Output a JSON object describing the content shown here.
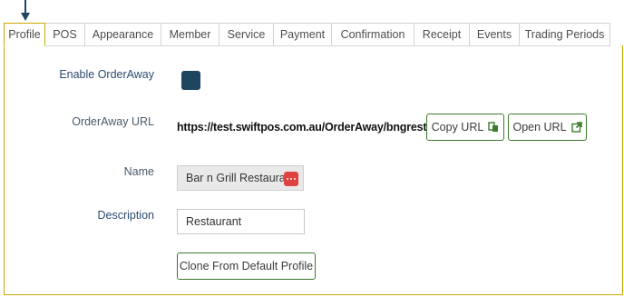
{
  "tabs": [
    {
      "label": "Profile",
      "active": true
    },
    {
      "label": "POS",
      "active": false
    },
    {
      "label": "Appearance",
      "active": false
    },
    {
      "label": "Member",
      "active": false
    },
    {
      "label": "Service",
      "active": false
    },
    {
      "label": "Payment",
      "active": false
    },
    {
      "label": "Confirmation",
      "active": false
    },
    {
      "label": "Receipt",
      "active": false
    },
    {
      "label": "Events",
      "active": false
    },
    {
      "label": "Trading Periods",
      "active": false
    }
  ],
  "form": {
    "enable_label": "Enable OrderAway",
    "enable_checked": true,
    "url_label": "OrderAway URL",
    "url_value": "https://test.swiftpos.com.au/OrderAway/bngrestaurant",
    "copy_url_label": "Copy URL",
    "copy_url_icon": "copy-icon",
    "open_url_label": "Open URL",
    "open_url_icon": "external-link-icon",
    "name_label": "Name",
    "name_value": "Bar n Grill Restaurant",
    "name_action_icon": "more-dots-icon",
    "description_label": "Description",
    "description_value": "Restaurant",
    "clone_button_label": "Clone From Default Profile"
  },
  "colors": {
    "accent_border": "#c9a800",
    "checkbox_fill": "#1d4560",
    "button_border": "#3c7a2c",
    "dots_icon_bg": "#e0433f",
    "arrow": "#1d4560"
  }
}
